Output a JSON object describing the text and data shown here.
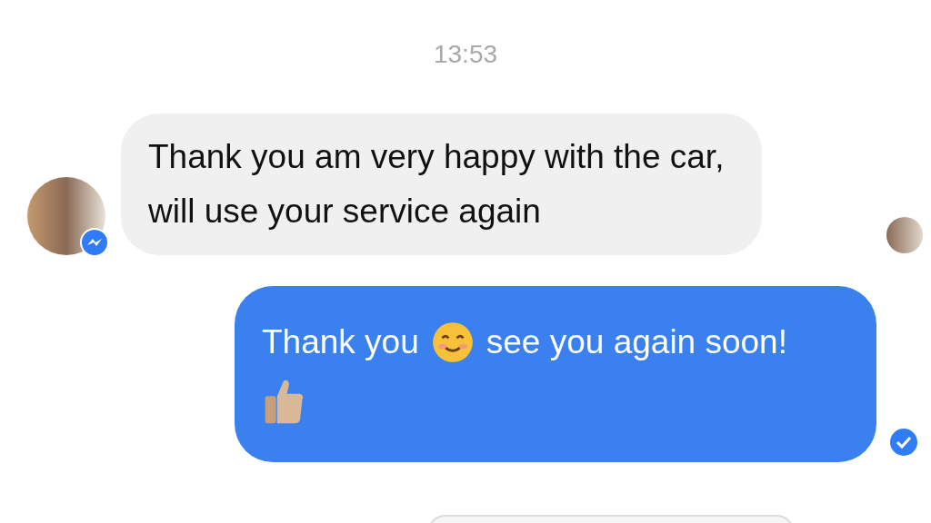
{
  "timestamp": "13:53",
  "messages": [
    {
      "kind": "incoming",
      "text": "Thank you am very happy with the car, will use your service again"
    },
    {
      "kind": "outgoing",
      "lines": [
        [
          {
            "kind": "text",
            "text": "Thank you"
          },
          {
            "kind": "smile"
          },
          {
            "kind": "text",
            "text": "see you again soon!"
          }
        ],
        [
          {
            "kind": "thumbs_up"
          }
        ]
      ]
    }
  ]
}
